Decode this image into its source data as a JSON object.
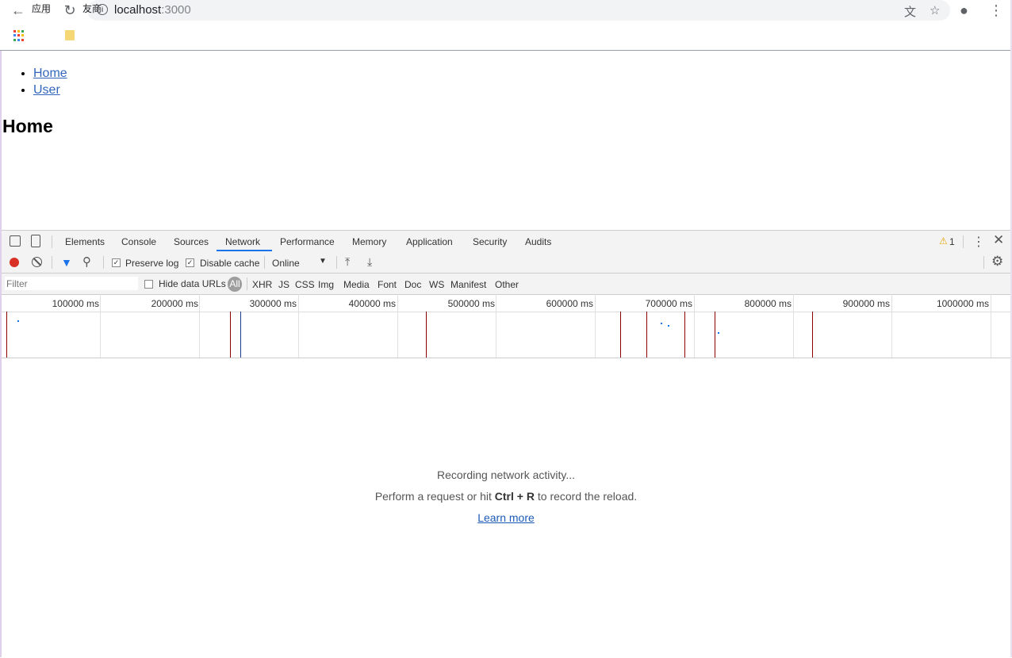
{
  "browser": {
    "url_host": "localhost",
    "url_port": ":3000",
    "bookmarks": [
      {
        "label": "应用"
      },
      {
        "label": "友商"
      }
    ]
  },
  "page": {
    "nav_links": [
      {
        "label": "Home"
      },
      {
        "label": "User"
      }
    ],
    "heading": "Home"
  },
  "devtools": {
    "tabs": [
      "Elements",
      "Console",
      "Sources",
      "Network",
      "Performance",
      "Memory",
      "Application",
      "Security",
      "Audits"
    ],
    "active_tab": "Network",
    "warning_count": "1",
    "toolbar": {
      "preserve_log_label": "Preserve log",
      "preserve_log_checked": true,
      "disable_cache_label": "Disable cache",
      "disable_cache_checked": true,
      "throttle_value": "Online"
    },
    "filter_bar": {
      "filter_placeholder": "Filter",
      "hide_data_urls_label": "Hide data URLs",
      "types": [
        "All",
        "XHR",
        "JS",
        "CSS",
        "Img",
        "Media",
        "Font",
        "Doc",
        "WS",
        "Manifest",
        "Other"
      ],
      "active_type": "All"
    },
    "overview": {
      "ticks": [
        "100000 ms",
        "200000 ms",
        "300000 ms",
        "400000 ms",
        "500000 ms",
        "600000 ms",
        "700000 ms",
        "800000 ms",
        "900000 ms",
        "1000000 ms"
      ]
    },
    "empty_state": {
      "line1": "Recording network activity...",
      "line2_prefix": "Perform a request or hit ",
      "shortcut_ctrl": "Ctrl",
      "shortcut_plus": " + ",
      "shortcut_r": "R",
      "line2_suffix": " to record the reload.",
      "learn_more": "Learn more"
    }
  },
  "colors": {
    "record_red": "#d93025",
    "active_tab_blue": "#1a73e8",
    "request_marker": "#8b0000"
  }
}
